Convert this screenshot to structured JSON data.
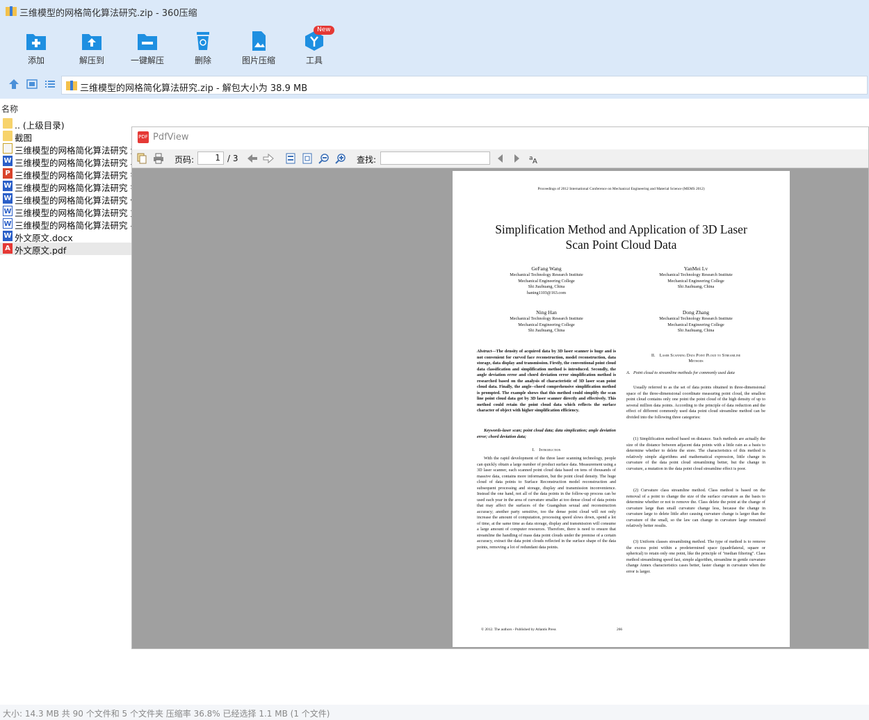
{
  "window": {
    "title": "三维模型的网格简化算法研究.zip - 360压缩"
  },
  "toolbar": {
    "add": "添加",
    "extract_to": "解压到",
    "one_click_extract": "一键解压",
    "delete": "删除",
    "image_compress": "图片压缩",
    "tools": "工具",
    "new_badge": "New"
  },
  "path": {
    "text": "三维模型的网格简化算法研究.zip - 解包大小为 38.9 MB"
  },
  "list": {
    "header": "名称",
    "items": [
      {
        "name": ".. (上级目录)",
        "icon": "folder-icon"
      },
      {
        "name": "截图",
        "icon": "folder-icon"
      },
      {
        "name": "三维模型的网格简化算法研究 源",
        "icon": "document-icon"
      },
      {
        "name": "三维模型的网格简化算法研究 毕",
        "icon": "word-icon"
      },
      {
        "name": "三维模型的网格简化算法研究 答",
        "icon": "powerpoint-icon"
      },
      {
        "name": "三维模型的网格简化算法研究 答",
        "icon": "word-icon"
      },
      {
        "name": "三维模型的网格简化算法研究 任",
        "icon": "word-icon"
      },
      {
        "name": "三维模型的网格简化算法研究 文",
        "icon": "word-outline-icon"
      },
      {
        "name": "三维模型的网格简化算法研究 -中",
        "icon": "word-outline-icon"
      },
      {
        "name": "外文原文.docx",
        "icon": "word-icon"
      },
      {
        "name": "外文原文.pdf",
        "icon": "pdf-icon"
      }
    ]
  },
  "status": {
    "text": "大小: 14.3 MB 共 90 个文件和 5 个文件夹 压缩率 36.8% 已经选择 1.1 MB (1 个文件)"
  },
  "pdfviewer": {
    "title": "PdfView",
    "page_label": "页码:",
    "page_current": "1",
    "page_total": "/ 3",
    "search_label": "查找:",
    "search_value": "",
    "page": {
      "header": "Proceedings of 2012 International Conference on Mechanical Engineering and Material Science (MEMS 2012)",
      "title_line1": "Simplification Method and Application of 3D Laser",
      "title_line2": "Scan Point Cloud Data",
      "authors": [
        {
          "name": "GeFang Wang",
          "lines": [
            "Mechanical Technology Research Institute",
            "Mechanical Engineering College",
            "Shi Jiazhuang, China",
            "haning1103@163.com"
          ]
        },
        {
          "name": "YanMei Lv",
          "lines": [
            "Mechanical Technology Research Institute",
            "Mechanical Engineering College",
            "Shi Jiazhuang, China"
          ]
        },
        {
          "name": "Ning Han",
          "lines": [
            "Mechanical Technology Research Institute",
            "Mechanical Engineering College",
            "Shi Jiazhuang, China"
          ]
        },
        {
          "name": "Dong Zhang",
          "lines": [
            "Mechanical Technology Research Institute",
            "Mechanical Engineering College",
            "Shi Jiazhuang, China"
          ]
        }
      ],
      "abstract_lead": "Abstract—",
      "abstract": "The density of acquired data by 3D laser scanner is huge and is not convenient for curved face reconstruction, model reconstruction, data storage, data display and transmission. Firstly, the conventional point cloud data classification and simplification method is introduced. Secondly, the angle deviation error and chord deviation error simplification method is researched based on the analysis of characteristic of 3D laser scan point cloud data. Finally, the angle--chord comprehensive simplification method is prompted. The example shows that this method could simplify the scan line point cloud data got by 3D laser scanner directly and effectively. This method could retain the point cloud data which reflects the surface character of object with higher simplification efficiency.",
      "keywords_lead": "Keywords-",
      "keywords": "laser scan; point cloud data; data simplication; angle deviation error; chord deviation data;",
      "intro_heading": "I.    Introduction",
      "intro": "With the rapid development of the three laser scanning technology, people can quickly obtain a large number of product surface data. Measurement using a 3D laser scanner, each scanned point cloud data based on tens of thousands of massive data, contains more information, but the point cloud density. The huge cloud of data points to Surface Reconstruction model reconstruction and subsequent processing and storage, display and transmission inconvenience. Instead the one hand, not all of the data points in the follow-up process can be used each year in the area of curvature smaller at too dense cloud of data points that may affect the surfaces of the Guangshun sexual and reconstruction accuracy; another party sensitive, too the dense point cloud will not only increase the amount of computation, processing speed slows down, spend a lot of time, at the same time as data storage, display and transmission will consume a large amount of computer resources. Therefore, there is need to ensure that streamline the handling of mass data point clouds under the premise of a certain accuracy, extract the data point clouds reflected in the surface shape of the data points, removing a lot of redundant data points.",
      "sec2_heading_line1": "II.    Laser Scanning Data Point Ploud to Streamline",
      "sec2_heading_line2": "Methods",
      "sec2a_heading": "A.   Point cloud to streamline methods for commonly used data",
      "sec2a_p1": "Usually referred to as the set of data points obtained in three-dimensional space of the three-dimensional coordinate measuring point cloud, the smallest point cloud contains only one point the point cloud of the high density of up to several million data points. According to the principle of data reduction and the effect of different commonly used data point cloud streamline method can be divided into the following three categories:",
      "sec2a_p2": "(1) Simplification method based on distance. Such methods are actually the size of the distance between adjacent data points with a little rain as a basis to determine whether to delete the store. The characteristics of this method is relatively simple algorithms and mathematical expression, little change in curvature of the data point cloud streamlining better, but the change in curvature, a mutation in the data point cloud streamline effect is poor.",
      "sec2a_p3": "(2) Curvature class streamline method. Class method is based on the removal of a point to change the size of the surface curvature as the basis to determine whether or not to remove the. Class delete the point at the change of curvature large than small curvature change less, because the change in curvature large to delete little after causing curvature change is larger than the curvature of the small, so the law can change in curvature large remained relatively better results.",
      "sec2a_p4": "(3) Uniform classes streamlining method. The type of method is to remove the excess point within a predetermined space (quadrilateral, square or spherical) to retain only one point, like the principle of \"median filtering\". Class method streamlining speed fast, simple algorithm, streamline in gentle curvature change Annex characteristics cases better, faster change in curvature when the error is larger.",
      "footer_left": "© 2012. The authors - Published by Atlantis Press",
      "footer_page": "266"
    }
  },
  "colors": {
    "chrome": "#dbe9f9",
    "accent": "#1e8fe1",
    "viewer_bg": "#a0a0a0"
  }
}
